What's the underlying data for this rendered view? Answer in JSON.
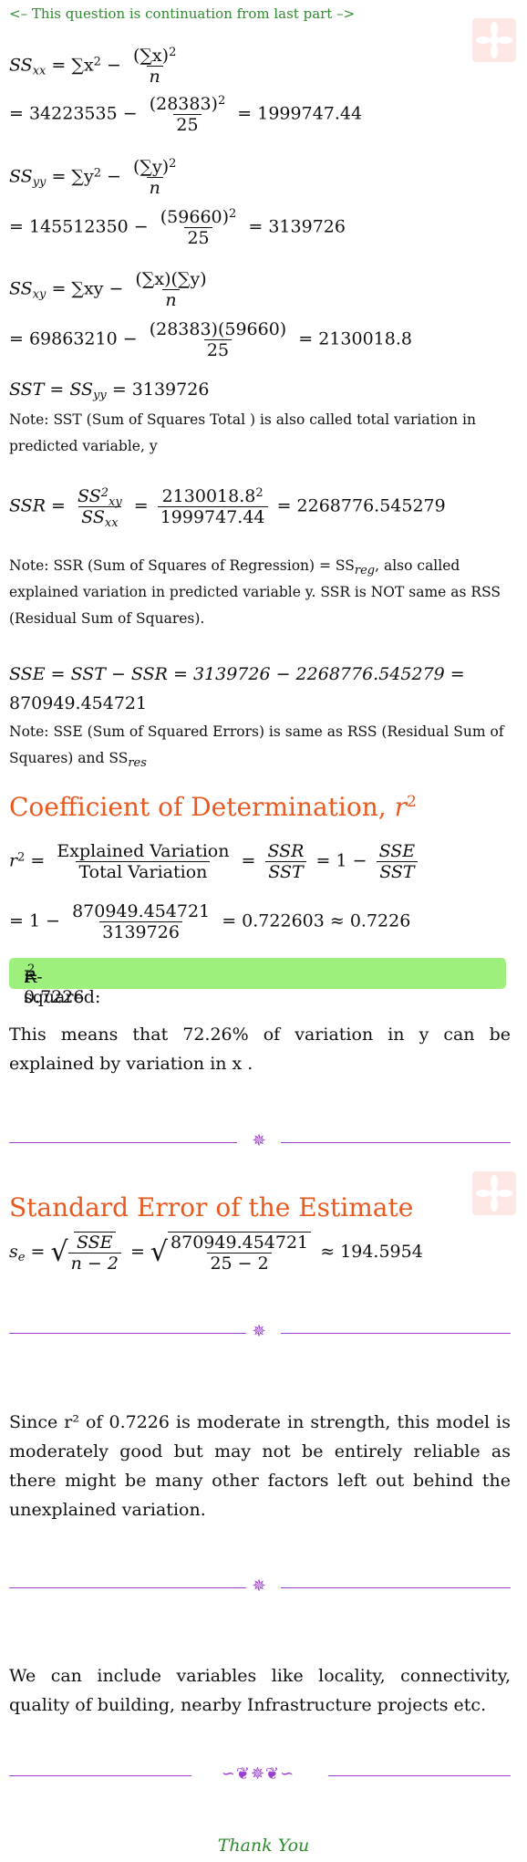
{
  "header_note": "<– This question is continuation from last part –>",
  "ssxx": {
    "lhs": "SS",
    "lhs_sub": "xx",
    "def_mid": "= ∑x",
    "def_num": "(∑x)",
    "def_den": "n",
    "calc_start": "= 34223535 −",
    "calc_num": "(28383)",
    "calc_den": "25",
    "calc_end": "= 1999747.44"
  },
  "ssyy": {
    "lhs": "SS",
    "lhs_sub": "yy",
    "def_mid": "= ∑y",
    "def_num": "(∑y)",
    "def_den": "n",
    "calc_start": "= 145512350 −",
    "calc_num": "(59660)",
    "calc_den": "25",
    "calc_end": "= 3139726"
  },
  "ssxy": {
    "lhs": "SS",
    "lhs_sub": "xy",
    "def_mid": "= ∑xy −",
    "def_num": "(∑x)(∑y)",
    "def_den": "n",
    "calc_start": "= 69863210 −",
    "calc_num": "(28383)(59660)",
    "calc_den": "25",
    "calc_end": "= 2130018.8"
  },
  "sst": {
    "line": "SST = SS",
    "sub": "yy",
    "value": "= 3139726",
    "note": "Note: SST (Sum of Squares Total ) is also called total variation in predicted variable, y"
  },
  "ssr": {
    "lhs": "SSR =",
    "f1_num": "SS",
    "f1_num_sub": "xy",
    "f1_den": "SS",
    "f1_den_sub": "xx",
    "f2_num": "2130018.8",
    "f2_den": "1999747.44",
    "result": "= 2268776.545279",
    "note_a": "Note: SSR (Sum of Squares of Regression) = SS",
    "note_sub": "reg",
    "note_b": ", also called explained variation in predicted variable y. SSR is NOT same as RSS (Residual Sum of Squares)."
  },
  "sse": {
    "line": "SSE = SST − SSR = 3139726 − 2268776.545279 =",
    "value": "870949.454721",
    "note_a": "Note: SSE (Sum of Squared Errors) is same as RSS (Residual Sum of Squares) and SS",
    "note_sub": "res"
  },
  "coef": {
    "heading": "Coefficient of Determination,",
    "heading_var": "r",
    "lhs": "r",
    "f1_num": "Explained Variation",
    "f1_den": "Total Variation",
    "f2_num": "SSR",
    "f2_den": "SST",
    "mid": "= 1 −",
    "f3_num": "SSE",
    "f3_den": "SST",
    "calc_start": "= 1 −",
    "calc_num": "870949.454721",
    "calc_den": "3139726",
    "calc_end": "= 0.722603 ≈ 0.7226",
    "box_label": "R-squared:",
    "box_value": "= 0.7226",
    "meaning": "This means that 72.26% of variation in y can be explained by variation in x ."
  },
  "se": {
    "heading": "Standard Error of the Estimate",
    "lhs": "s",
    "lhs_sub": "e",
    "r1_num": "SSE",
    "r1_den": "n − 2",
    "r2_num": "870949.454721",
    "r2_den": "25 − 2",
    "result": "≈ 194.5954"
  },
  "conclusion": "Since r² of 0.7226 is moderate in strength, this model is moderately good but may not be entirely reliable as there might be many other factors left out behind the unexplained variation.",
  "suggestion": "We can include variables like locality, connectivity, quality of building, nearby Infrastructure projects etc.",
  "thanks": "Thank You",
  "colors": {
    "heading": "#e85a20",
    "green_text": "#2f8a2f",
    "highlight_box": "#9ef07c",
    "divider": "#9a3fd0"
  },
  "icons": [
    "watermark-flower-icon",
    "ornament-divider-icon"
  ]
}
